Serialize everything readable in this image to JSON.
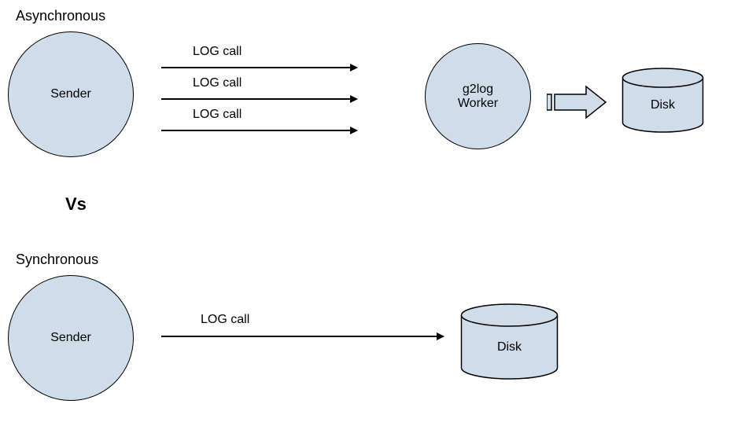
{
  "top": {
    "title": "Asynchronous",
    "sender": "Sender",
    "worker": "g2log\nWorker",
    "disk": "Disk",
    "arrows": [
      "LOG call",
      "LOG call",
      "LOG call"
    ]
  },
  "vs": "Vs",
  "bottom": {
    "title": "Synchronous",
    "sender": "Sender",
    "disk": "Disk",
    "arrow": "LOG call"
  },
  "colors": {
    "fill": "#cfdce9",
    "stroke": "#000000"
  }
}
